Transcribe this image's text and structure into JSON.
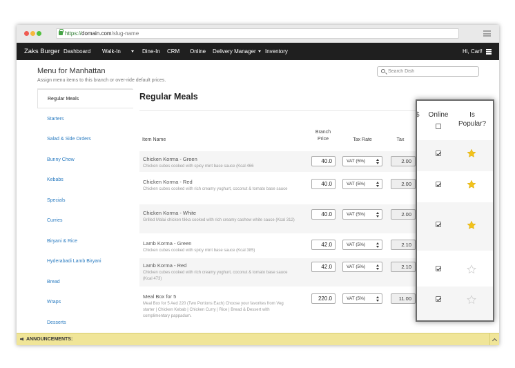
{
  "browser": {
    "url_secure": "https://",
    "url_domain": "domain.com",
    "url_path": "/slug-name"
  },
  "nav": {
    "brand": "Zaks Burger",
    "items": [
      "Dashboard",
      "Walk-In",
      "Dine-In",
      "CRM",
      "Online",
      "Delivery Manager",
      "Inventory"
    ],
    "user": "Hi, Carl!"
  },
  "header": {
    "title": "Menu for Manhattan",
    "subtitle": "Assign menu items to this branch or over-ride default prices.",
    "search_placeholder": "Search Dish"
  },
  "sidebar": {
    "items": [
      "Regular Meals",
      "Starters",
      "Salad & Side Orders",
      "Bunny Chow",
      "Kebabs",
      "Specials",
      "Curries",
      "Biryani & Rice",
      "Hyderabadi Lamb Biryani",
      "Bread",
      "Wraps",
      "Desserts"
    ]
  },
  "main": {
    "title": "Regular Meals",
    "columns": {
      "item_name": "Item Name",
      "branch_price": "Branch Price",
      "branch_price_l1": "Branch",
      "branch_price_l2": "Price",
      "tax_rate": "Tax Rate",
      "tax": "Tax"
    },
    "rows": [
      {
        "name": "Chicken Korma - Green",
        "desc": "Chicken cubes cooked with spicy mint base sauce (Kcal 466",
        "price": "40.0",
        "tax_rate": "VAT (5%)",
        "tax": "2.00"
      },
      {
        "name": "Chicken Korma - Red",
        "desc": "Chicken cubes cooked with rich creamy yoghurt, coconut & tomato base sauce",
        "price": "40.0",
        "tax_rate": "VAT (5%)",
        "tax": "2.00"
      },
      {
        "name": "Chicken Korma - White",
        "desc": "Grilled Malai chicken tikka cooked with rich creamy cashew white sauce (Kcal 312)",
        "price": "40.0",
        "tax_rate": "VAT (5%)",
        "tax": "2.00"
      },
      {
        "name": "Lamb Korma - Green",
        "desc": "Chicken cubes cooked with spicy mint base sauce (Kcal 385)",
        "price": "42.0",
        "tax_rate": "VAT (5%)",
        "tax": "2.10"
      },
      {
        "name": "Lamb Korma - Red",
        "desc": "Chicken cubes cooked with rich creamy yoghurt, coconut & tomato base sauce (Kcal 473)",
        "price": "42.0",
        "tax_rate": "VAT (5%)",
        "tax": "2.10"
      },
      {
        "name": "Meal Box for 5",
        "desc": "Meal Box for 5 Aed 220 (Two Portions Each) Choose your favorites from Veg starter | Chicken Kebab | Chicken Curry | Rice | Bread & Dessert with complimentary pappadum.",
        "price": "220.0",
        "tax_rate": "VAT (5%)",
        "tax": "11.00"
      }
    ]
  },
  "popup": {
    "edge_char": "$",
    "online_label": "Online",
    "popular_label_l1": "Is",
    "popular_label_l2": "Popular?",
    "rows": [
      {
        "online": true,
        "popular": true
      },
      {
        "online": true,
        "popular": true
      },
      {
        "online": true,
        "popular": true
      },
      {
        "online": true,
        "popular": false
      },
      {
        "online": true,
        "popular": false
      }
    ]
  },
  "announcements": {
    "label": "ANNOUNCEMENTS:"
  },
  "colors": {
    "nav_bg": "#1f1f1f",
    "link": "#2b7cc1",
    "star_active": "#f2c21b",
    "announce_bg": "#f0e598"
  }
}
